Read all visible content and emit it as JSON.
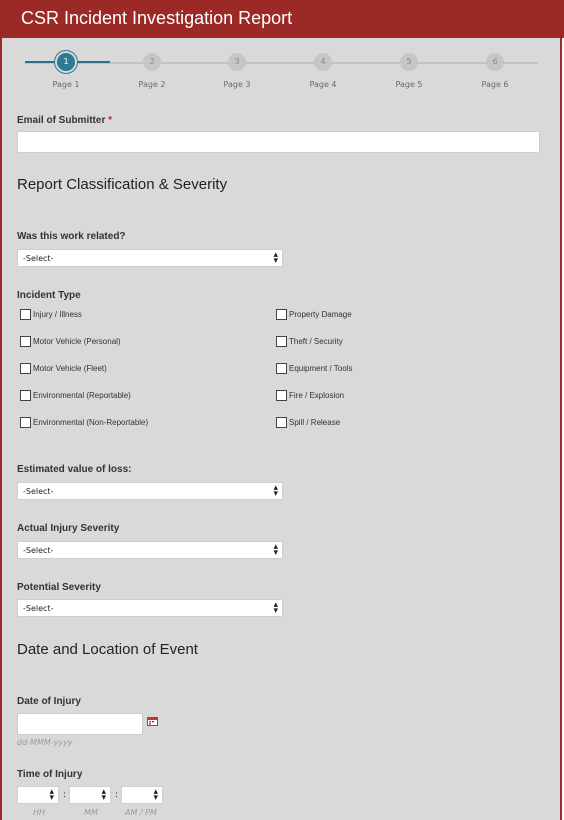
{
  "header": {
    "title": "CSR Incident Investigation Report"
  },
  "steps": [
    {
      "num": "1",
      "label": "Page 1"
    },
    {
      "num": "2",
      "label": "Page 2"
    },
    {
      "num": "3",
      "label": "Page 3"
    },
    {
      "num": "4",
      "label": "Page 4"
    },
    {
      "num": "5",
      "label": "Page 5"
    },
    {
      "num": "6",
      "label": "Page 6"
    }
  ],
  "email": {
    "label": "Email of Submitter",
    "required_mark": "*",
    "value": ""
  },
  "section1": {
    "title": "Report Classification & Severity"
  },
  "work_related": {
    "label": "Was this work related?",
    "value": "-Select-"
  },
  "incident_type": {
    "label": "Incident Type",
    "options_left": [
      "Injury / Illness",
      "Motor Vehicle (Personal)",
      "Motor Vehicle (Fleet)",
      "Environmental (Reportable)",
      "Environmental (Non-Reportable)"
    ],
    "options_right": [
      "Property Damage",
      "Theft / Security",
      "Equipment / Tools",
      "Fire / Explosion",
      "Spill / Release"
    ]
  },
  "estimated_loss": {
    "label": "Estimated value of loss:",
    "value": "-Select-"
  },
  "actual_severity": {
    "label": "Actual Injury Severity",
    "value": "-Select-"
  },
  "potential_severity": {
    "label": "Potential Severity",
    "value": "-Select-"
  },
  "section2": {
    "title": "Date and Location of Event"
  },
  "date_of_injury": {
    "label": "Date of Injury",
    "value": "",
    "format_hint": "dd-MMM-yyyy"
  },
  "time_of_injury": {
    "label": "Time of Injury",
    "hh": "HH",
    "mm": "MM",
    "ampm": "AM / PM",
    "separator": ":"
  },
  "colors": {
    "header": "#9b2a27",
    "active_step": "#2b7b94",
    "background": "#d9d9d9"
  }
}
